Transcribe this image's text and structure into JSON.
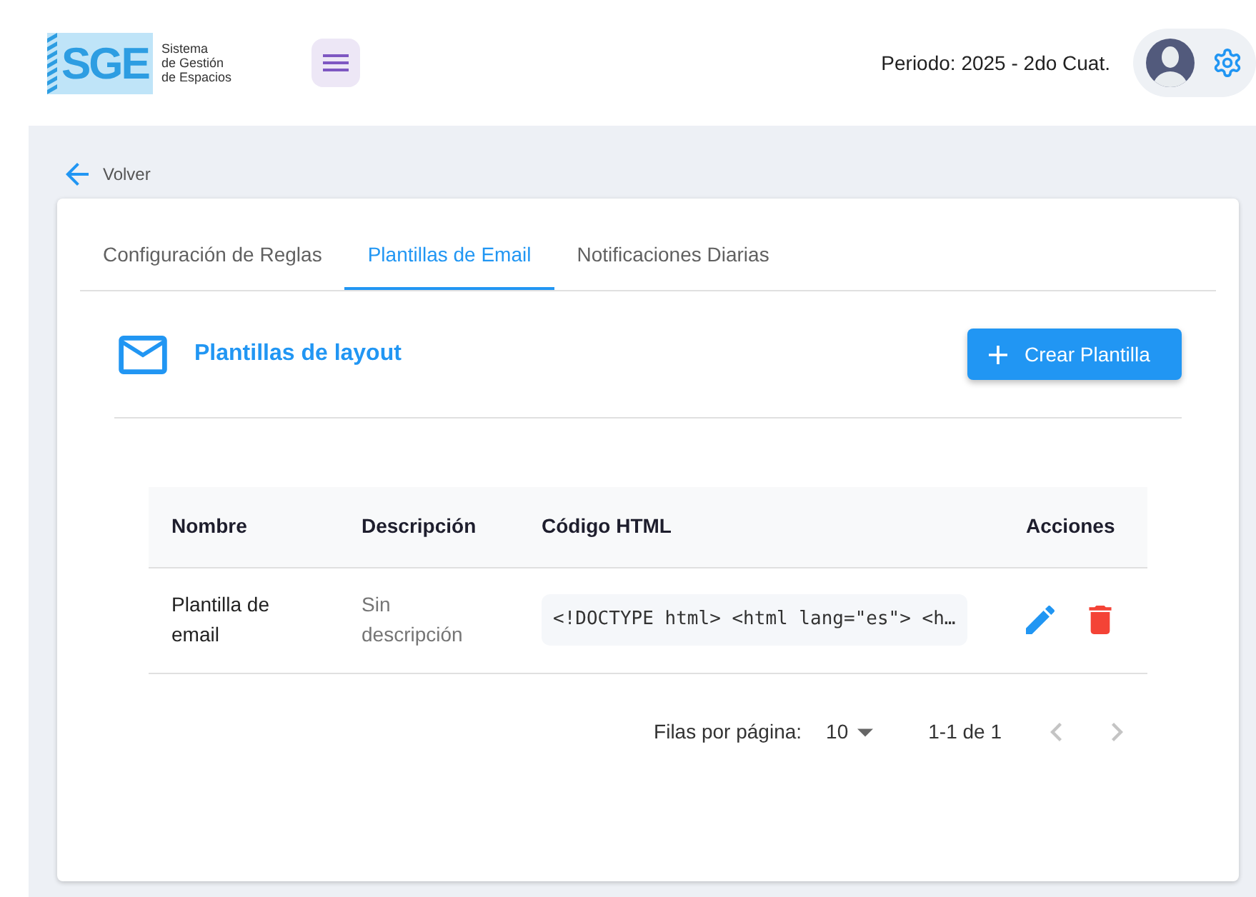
{
  "header": {
    "logo": {
      "mark": "SGE",
      "caption": "Sistema\nde Gestión\nde Espacios"
    },
    "period": "Periodo: 2025 - 2do Cuat."
  },
  "back_link": {
    "label": "Volver"
  },
  "tabs": [
    {
      "label": "Configuración de Reglas",
      "selected": false
    },
    {
      "label": "Plantillas de Email",
      "selected": true
    },
    {
      "label": "Notificaciones Diarias",
      "selected": false
    }
  ],
  "section": {
    "title": "Plantillas de layout",
    "create_button": {
      "label": "Crear Plantilla"
    }
  },
  "table": {
    "columns": [
      "Nombre",
      "Descripción",
      "Código HTML",
      "Acciones"
    ],
    "rows": [
      {
        "nombre": "Plantilla de email",
        "descripcion": "Sin descripción",
        "codigo_html": "<!DOCTYPE html> <html lang=\"es\"> <h…"
      }
    ]
  },
  "pagination": {
    "rows_per_page_label": "Filas por página:",
    "rows_per_page": "10",
    "range": "1-1 de 1",
    "previous": {
      "disabled": true
    },
    "next": {
      "disabled": true
    }
  }
}
